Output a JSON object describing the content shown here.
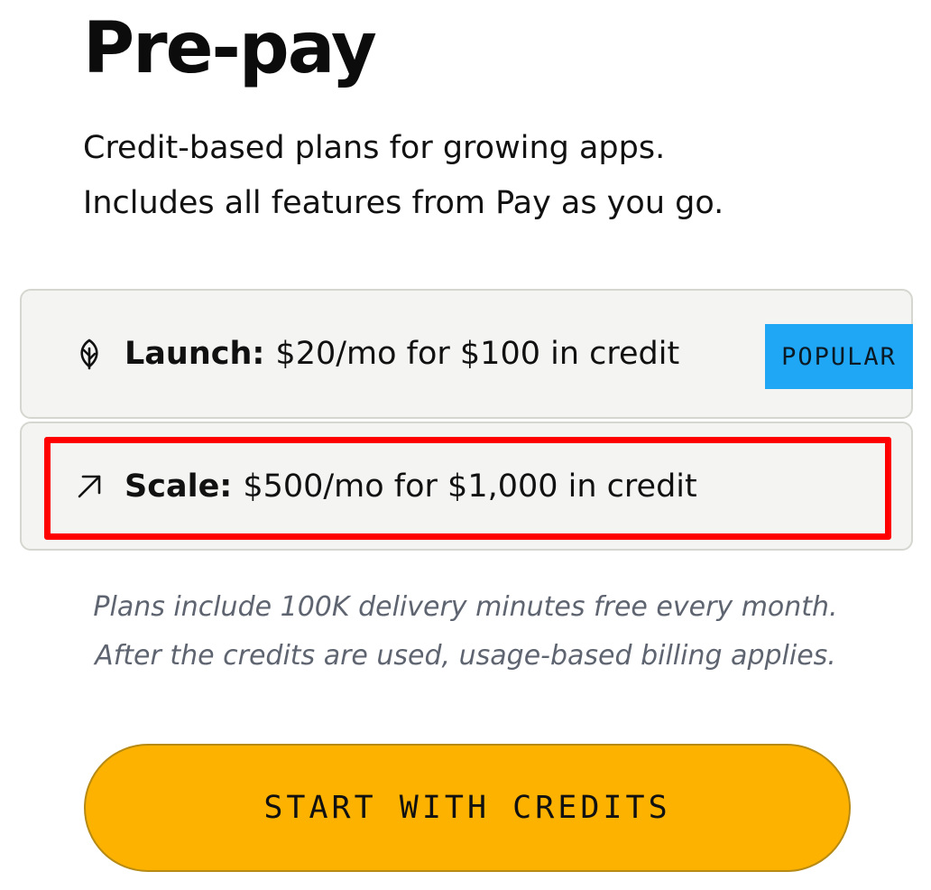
{
  "header": {
    "title": "Pre-pay",
    "subtitle_lines": [
      "Credit-based plans for growing apps.",
      "Includes all features from Pay as you go."
    ]
  },
  "plans": [
    {
      "icon": "leaf-icon",
      "name": "Launch:",
      "description": "$20/mo for $100 in credit",
      "badge": "POPULAR",
      "badge_color": "#1fa6f5"
    },
    {
      "icon": "arrow-up-right-icon",
      "name": "Scale:",
      "description": "$500/mo for $1,000 in credit",
      "highlighted": true,
      "highlight_color": "#ff0000"
    }
  ],
  "note_lines": [
    "Plans include 100K delivery minutes free every month.",
    "After the credits are used, usage-based billing applies."
  ],
  "cta": {
    "label": "START WITH CREDITS",
    "color": "#fdb200"
  }
}
